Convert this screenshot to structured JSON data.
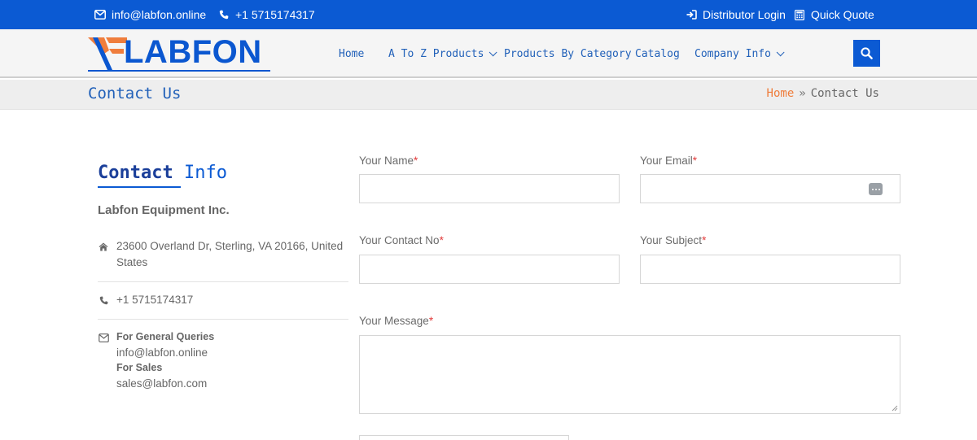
{
  "topbar": {
    "email": "info@labfon.online",
    "phone": "+1 5715174317",
    "distributor_login": "Distributor Login",
    "quick_quote": "Quick Quote"
  },
  "logo": {
    "text": "LABFON"
  },
  "nav": {
    "home": "Home",
    "a_to_z": "A To Z Products",
    "by_category": "Products By Category",
    "catalog": "Catalog",
    "company_info": "Company Info"
  },
  "breadcrumb": {
    "page_title": "Contact Us",
    "home": "Home",
    "separator": "»",
    "current": "Contact Us"
  },
  "contact_info": {
    "heading_bold": "Contact",
    "heading_light": "Info",
    "company": "Labfon Equipment Inc.",
    "address": "23600 Overland Dr, Sterling, VA 20166, United States",
    "phone": "+1 5715174317",
    "general_label": "For General Queries",
    "general_email": "info@labfon.online",
    "sales_label": "For Sales",
    "sales_email": "sales@labfon.com"
  },
  "form": {
    "name_label": "Your Name",
    "email_label": "Your Email",
    "contact_label": "Your Contact No",
    "subject_label": "Your Subject",
    "message_label": "Your Message",
    "required_mark": "*",
    "name_value": "",
    "email_value": "",
    "contact_value": "",
    "subject_value": "",
    "message_value": ""
  },
  "colors": {
    "brand_blue": "#0b5ad3",
    "nav_text": "#2261b9",
    "accent_orange": "#ef7d3c",
    "required_red": "#e23b3b"
  },
  "icons": [
    "envelope-icon",
    "phone-icon",
    "sign-in-icon",
    "calculator-icon",
    "search-icon",
    "home-icon",
    "chevron-down-icon"
  ]
}
